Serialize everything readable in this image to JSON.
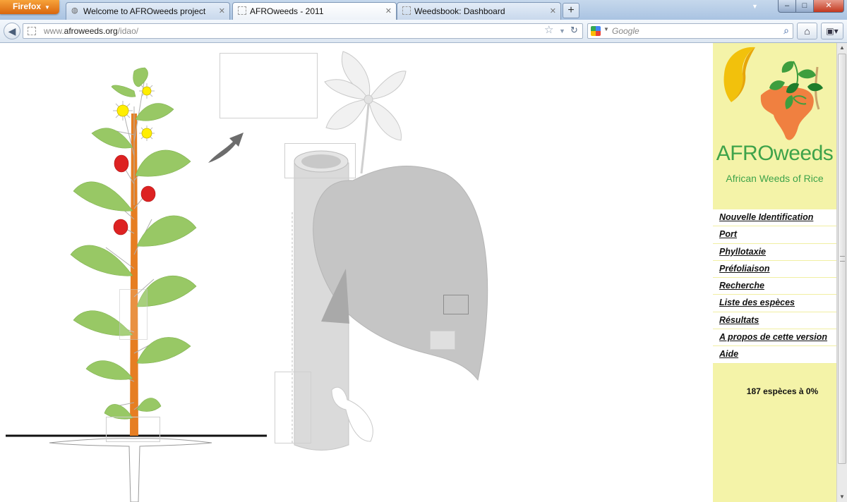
{
  "browser": {
    "app_button": "Firefox",
    "tabs": [
      {
        "label": "Welcome to AFROweeds project",
        "active": false
      },
      {
        "label": "AFROweeds - 2011",
        "active": true
      },
      {
        "label": "Weedsbook: Dashboard",
        "active": false
      }
    ],
    "new_tab": "+",
    "url_prefix": "www.",
    "url_domain": "afroweeds.org",
    "url_path": "/idao/",
    "search_placeholder": "Google",
    "window_controls": {
      "minimize": "–",
      "maximize": "□",
      "close": "✕"
    }
  },
  "sidebar": {
    "logo_title": "AFROweeds",
    "logo_subtitle": "African Weeds of Rice",
    "menu": [
      "Nouvelle Identification",
      "Port",
      "Phyllotaxie",
      "Préfoliaison",
      "Recherche",
      "Liste des espèces",
      "Résultats",
      "A propos de cette version",
      "Aide"
    ],
    "species_count": "187 espèces à 0%"
  },
  "colors": {
    "sidebar_bg": "#f4f3a8",
    "logo_green": "#3ea34a",
    "leaf_green": "#98c865",
    "stem_orange": "#e67e22",
    "fruit_red": "#dd2222",
    "flower_yellow": "#ffee00",
    "ghost_gray": "#cccccc"
  }
}
